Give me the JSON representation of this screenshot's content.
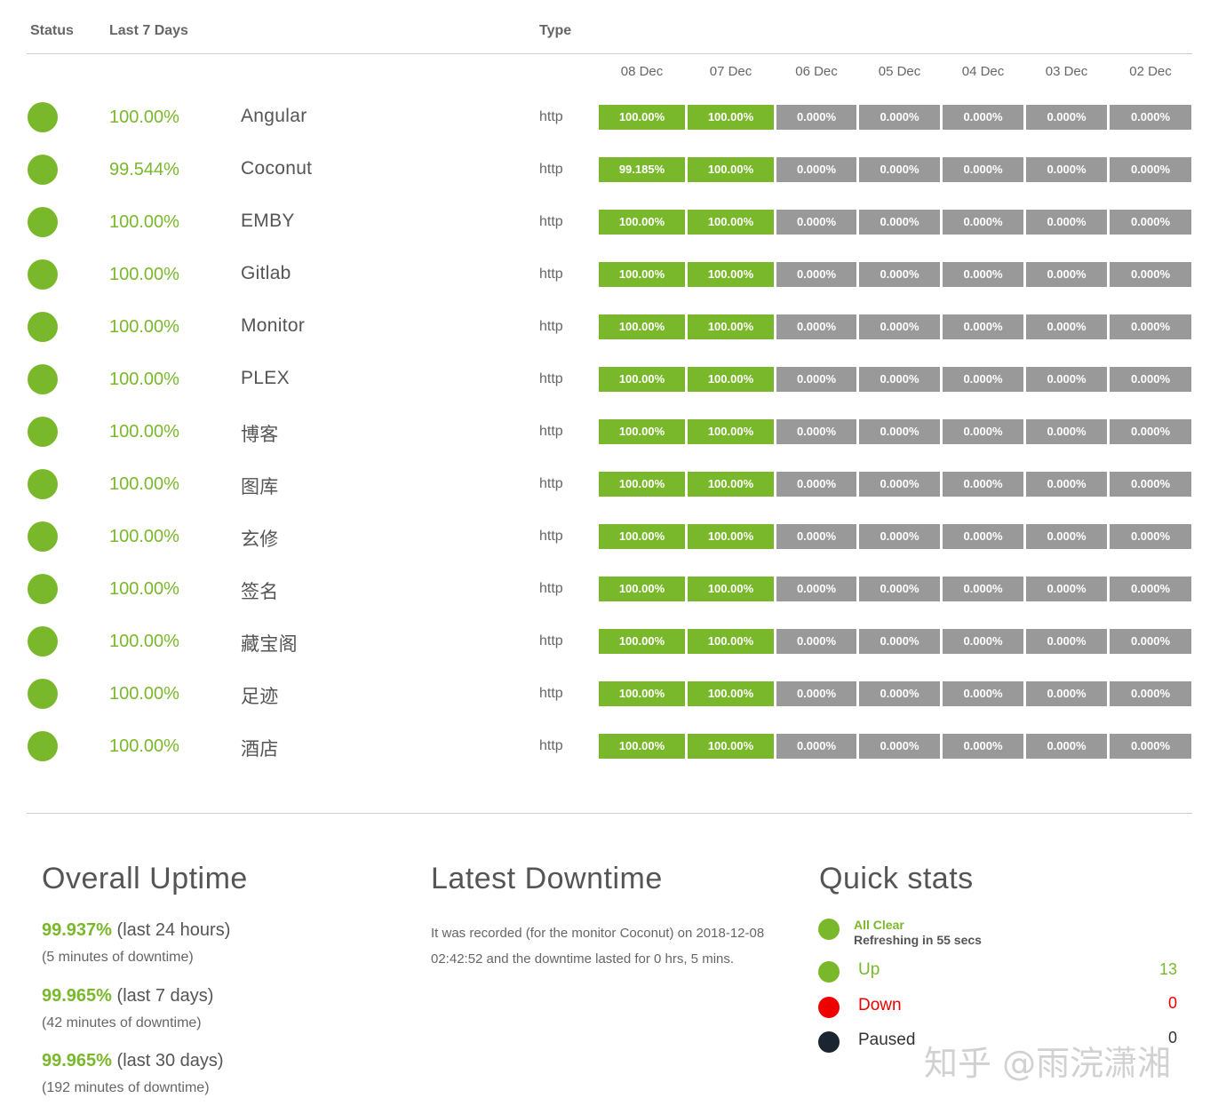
{
  "header": {
    "status": "Status",
    "last7": "Last 7 Days",
    "type": "Type"
  },
  "days": [
    "08 Dec",
    "07 Dec",
    "06 Dec",
    "05 Dec",
    "04 Dec",
    "03 Dec",
    "02 Dec"
  ],
  "colors": {
    "green": "#7ab82b",
    "gray": "#999999",
    "red": "#ee0000",
    "dark": "#1a2530"
  },
  "monitors": [
    {
      "name": "Angular",
      "pct": "100.00%",
      "type": "http",
      "days": [
        "100.00%",
        "100.00%",
        "0.000%",
        "0.000%",
        "0.000%",
        "0.000%",
        "0.000%"
      ]
    },
    {
      "name": "Coconut",
      "pct": "99.544%",
      "type": "http",
      "days": [
        "99.185%",
        "100.00%",
        "0.000%",
        "0.000%",
        "0.000%",
        "0.000%",
        "0.000%"
      ]
    },
    {
      "name": "EMBY",
      "pct": "100.00%",
      "type": "http",
      "days": [
        "100.00%",
        "100.00%",
        "0.000%",
        "0.000%",
        "0.000%",
        "0.000%",
        "0.000%"
      ]
    },
    {
      "name": "Gitlab",
      "pct": "100.00%",
      "type": "http",
      "days": [
        "100.00%",
        "100.00%",
        "0.000%",
        "0.000%",
        "0.000%",
        "0.000%",
        "0.000%"
      ]
    },
    {
      "name": "Monitor",
      "pct": "100.00%",
      "type": "http",
      "days": [
        "100.00%",
        "100.00%",
        "0.000%",
        "0.000%",
        "0.000%",
        "0.000%",
        "0.000%"
      ]
    },
    {
      "name": "PLEX",
      "pct": "100.00%",
      "type": "http",
      "days": [
        "100.00%",
        "100.00%",
        "0.000%",
        "0.000%",
        "0.000%",
        "0.000%",
        "0.000%"
      ]
    },
    {
      "name": "博客",
      "pct": "100.00%",
      "type": "http",
      "days": [
        "100.00%",
        "100.00%",
        "0.000%",
        "0.000%",
        "0.000%",
        "0.000%",
        "0.000%"
      ]
    },
    {
      "name": "图库",
      "pct": "100.00%",
      "type": "http",
      "days": [
        "100.00%",
        "100.00%",
        "0.000%",
        "0.000%",
        "0.000%",
        "0.000%",
        "0.000%"
      ]
    },
    {
      "name": "玄修",
      "pct": "100.00%",
      "type": "http",
      "days": [
        "100.00%",
        "100.00%",
        "0.000%",
        "0.000%",
        "0.000%",
        "0.000%",
        "0.000%"
      ]
    },
    {
      "name": "签名",
      "pct": "100.00%",
      "type": "http",
      "days": [
        "100.00%",
        "100.00%",
        "0.000%",
        "0.000%",
        "0.000%",
        "0.000%",
        "0.000%"
      ]
    },
    {
      "name": "藏宝阁",
      "pct": "100.00%",
      "type": "http",
      "days": [
        "100.00%",
        "100.00%",
        "0.000%",
        "0.000%",
        "0.000%",
        "0.000%",
        "0.000%"
      ]
    },
    {
      "name": "足迹",
      "pct": "100.00%",
      "type": "http",
      "days": [
        "100.00%",
        "100.00%",
        "0.000%",
        "0.000%",
        "0.000%",
        "0.000%",
        "0.000%"
      ]
    },
    {
      "name": "酒店",
      "pct": "100.00%",
      "type": "http",
      "days": [
        "100.00%",
        "100.00%",
        "0.000%",
        "0.000%",
        "0.000%",
        "0.000%",
        "0.000%"
      ]
    }
  ],
  "overall": {
    "title": "Overall Uptime",
    "items": [
      {
        "value": "99.937%",
        "period": "(last 24 hours)",
        "downtime": "(5 minutes of downtime)"
      },
      {
        "value": "99.965%",
        "period": "(last 7 days)",
        "downtime": "(42 minutes of downtime)"
      },
      {
        "value": "99.965%",
        "period": "(last 30 days)",
        "downtime": "(192 minutes of downtime)"
      }
    ]
  },
  "latest": {
    "title": "Latest Downtime",
    "text": "It was recorded (for the monitor Coconut) on 2018-12-08 02:42:52 and the downtime lasted for 0 hrs, 5 mins."
  },
  "quick": {
    "title": "Quick stats",
    "all_clear": "All Clear",
    "refreshing": "Refreshing in 55 secs",
    "up_label": "Up",
    "up_count": "13",
    "down_label": "Down",
    "down_count": "0",
    "paused_label": "Paused",
    "paused_count": "0"
  },
  "watermark": "知乎 @雨浣潇湘"
}
